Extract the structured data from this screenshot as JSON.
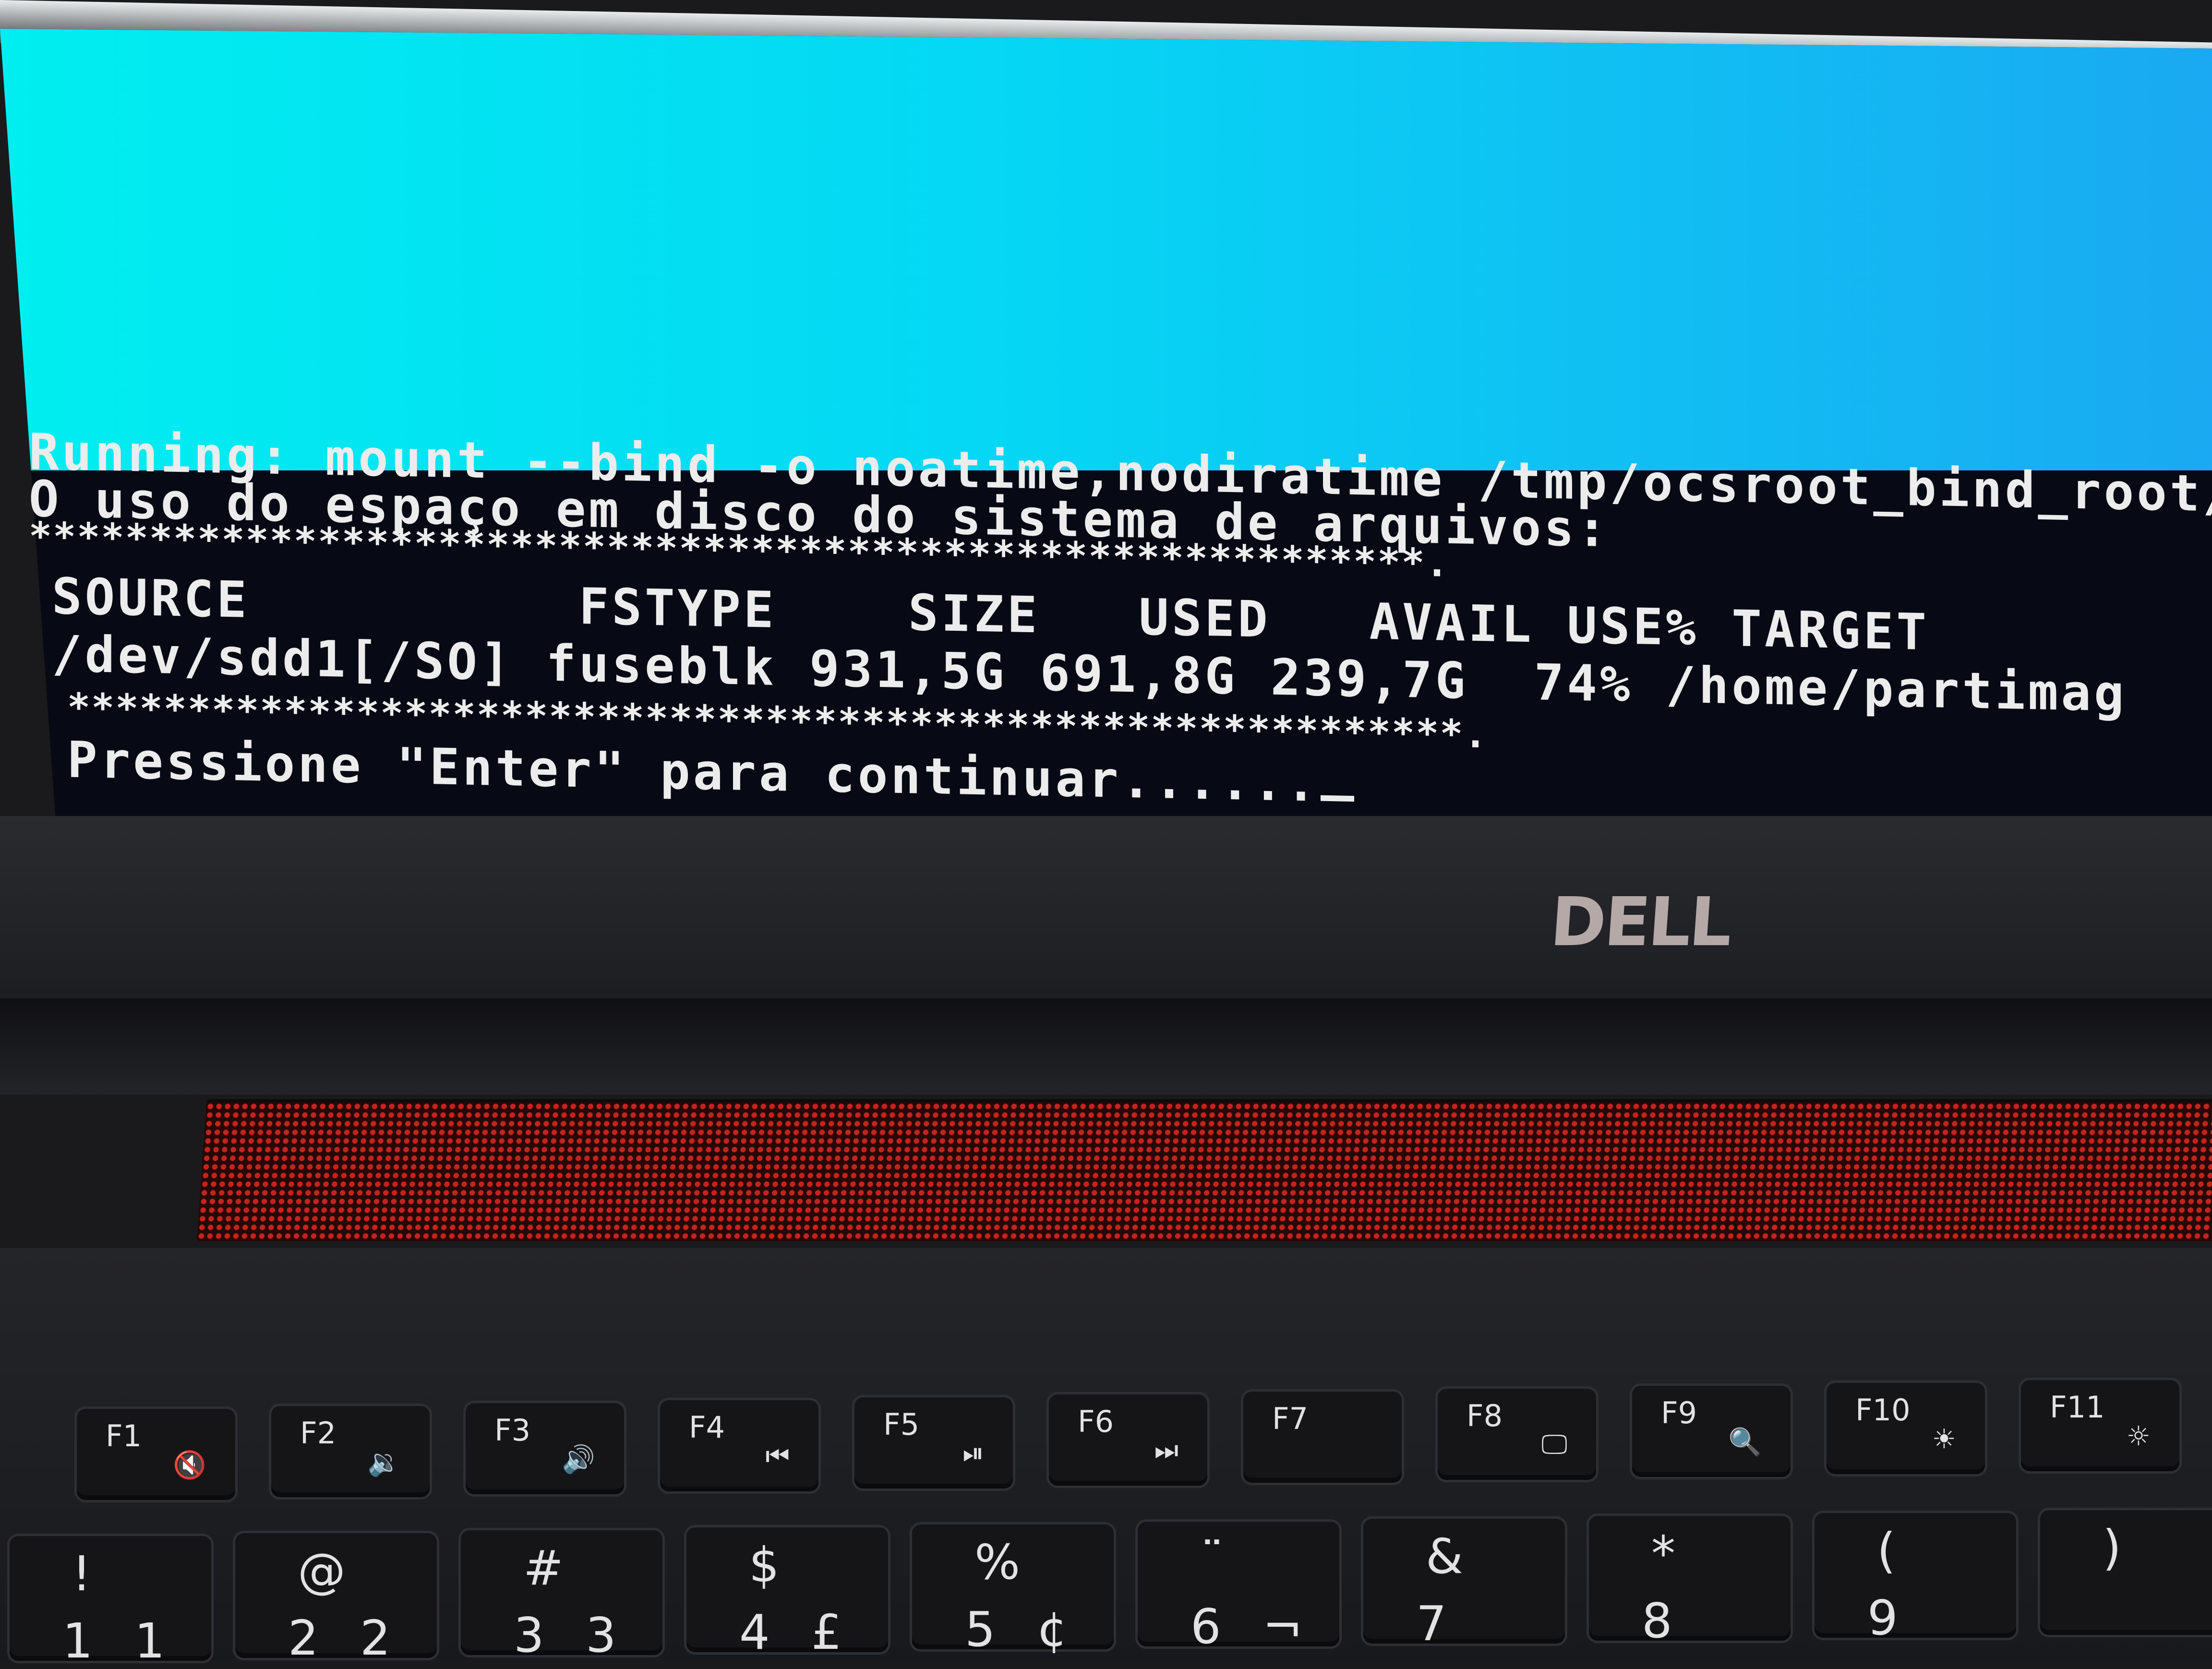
{
  "terminal": {
    "lines": [
      "Running: mount --bind -o noatime,nodiratime /tmp/ocsroot_bind_root/",
      "O uso do espaço em disco do sistema de arquivos:",
      "**********************************************************.",
      "SOURCE          FSTYPE    SIZE   USED   AVAIL USE% TARGET",
      "/dev/sdd1[/SO] fuseblk 931,5G 691,8G 239,7G  74% /home/partimag",
      "**********************************************************.",
      "Pressione \"Enter\" para continuar......"
    ]
  },
  "logo": "DELL",
  "keyboard": {
    "function_keys": [
      {
        "label": "F1",
        "icon": "mute-icon",
        "glyph": "🔇"
      },
      {
        "label": "F2",
        "icon": "volume-down-icon",
        "glyph": "🔉"
      },
      {
        "label": "F3",
        "icon": "volume-up-icon",
        "glyph": "🔊"
      },
      {
        "label": "F4",
        "icon": "previous-track-icon",
        "glyph": "⏮"
      },
      {
        "label": "F5",
        "icon": "play-pause-icon",
        "glyph": "⏯"
      },
      {
        "label": "F6",
        "icon": "next-track-icon",
        "glyph": "⏭"
      },
      {
        "label": "F7",
        "icon": "",
        "glyph": ""
      },
      {
        "label": "F8",
        "icon": "display-icon",
        "glyph": "🖵"
      },
      {
        "label": "F9",
        "icon": "search-icon",
        "glyph": "🔍"
      },
      {
        "label": "F10",
        "icon": "backlight-icon",
        "glyph": "☀"
      },
      {
        "label": "F11",
        "icon": "brightness-icon",
        "glyph": "☼"
      }
    ],
    "number_keys": [
      {
        "top": "!",
        "bottom": "1",
        "alt": "1"
      },
      {
        "top": "@",
        "bottom": "2",
        "alt": "2"
      },
      {
        "top": "#",
        "bottom": "3",
        "alt": "3"
      },
      {
        "top": "$",
        "bottom": "4",
        "alt": "£"
      },
      {
        "top": "%",
        "bottom": "5",
        "alt": "¢"
      },
      {
        "top": "¨",
        "bottom": "6",
        "alt": "¬"
      },
      {
        "top": "&",
        "bottom": "7",
        "alt": ""
      },
      {
        "top": "*",
        "bottom": "8",
        "alt": ""
      },
      {
        "top": "(",
        "bottom": "9",
        "alt": ""
      },
      {
        "top": ")",
        "bottom": "",
        "alt": ""
      }
    ]
  },
  "colors": {
    "screen_blue_left": "#00eef0",
    "screen_blue_right": "#1aa9f2",
    "terminal_text": "#ececec",
    "speaker_red": "#c4231b"
  }
}
